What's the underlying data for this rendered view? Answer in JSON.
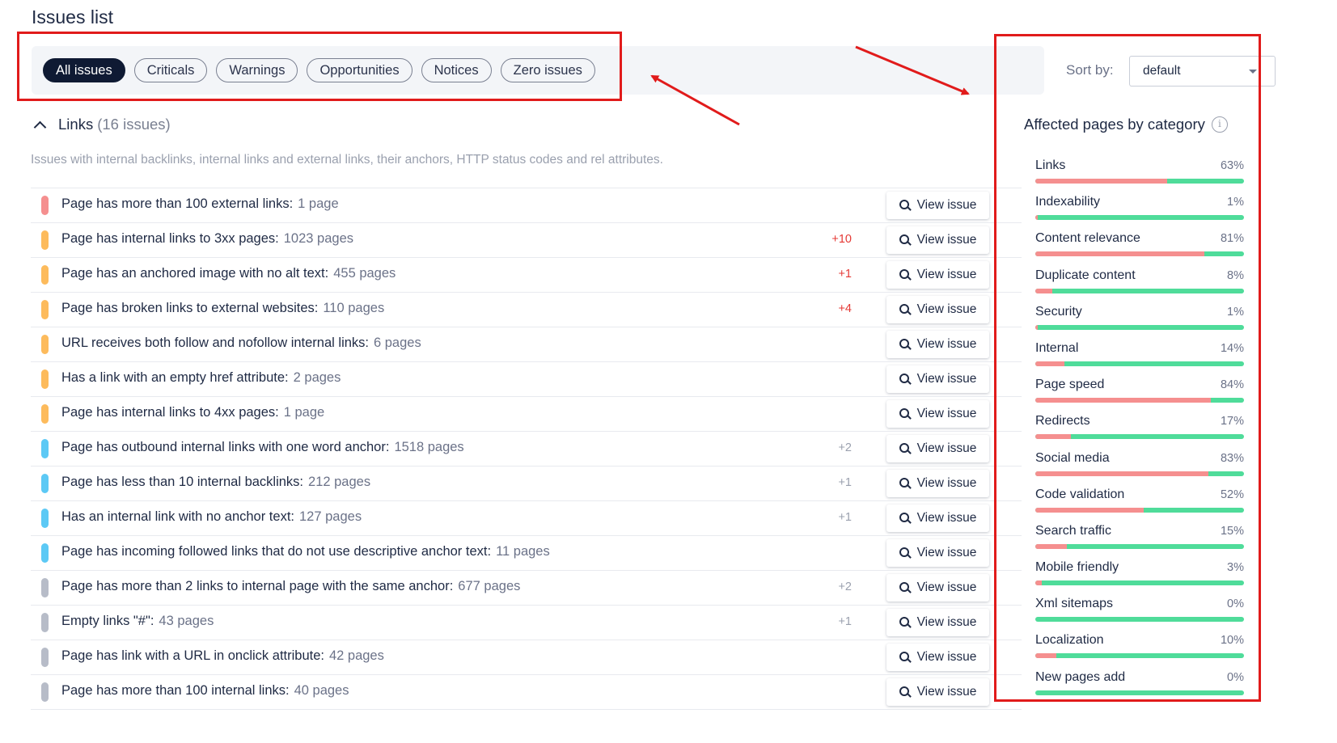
{
  "page_title": "Issues list",
  "filters": {
    "tabs": [
      {
        "label": "All issues",
        "active": true
      },
      {
        "label": "Criticals",
        "active": false
      },
      {
        "label": "Warnings",
        "active": false
      },
      {
        "label": "Opportunities",
        "active": false
      },
      {
        "label": "Notices",
        "active": false
      },
      {
        "label": "Zero issues",
        "active": false
      }
    ]
  },
  "sort": {
    "label": "Sort by:",
    "value": "default"
  },
  "section": {
    "title": "Links",
    "count": "(16 issues)",
    "description": "Issues with internal backlinks, internal links and external links, their anchors, HTTP status codes and rel attributes."
  },
  "colors": {
    "critical": "#f58f8f",
    "warning": "#fdbb5c",
    "opportunity": "#5cc9f5",
    "notice": "#b7bcc8",
    "delta_up": "#e53935",
    "delta_neutral": "#9aa0ae",
    "bar_affected": "#f58f8f",
    "bar_ok": "#4fdc9a",
    "annotation": "#e11b1b"
  },
  "view_label": "View issue",
  "issues": [
    {
      "text": "Page has more than 100 external links:",
      "count": "1 page",
      "delta": "",
      "severity": "critical"
    },
    {
      "text": "Page has internal links to 3xx pages:",
      "count": "1023 pages",
      "delta": "+10",
      "severity": "warning"
    },
    {
      "text": "Page has an anchored image with no alt text:",
      "count": "455 pages",
      "delta": "+1",
      "severity": "warning"
    },
    {
      "text": "Page has broken links to external websites:",
      "count": "110 pages",
      "delta": "+4",
      "severity": "warning"
    },
    {
      "text": "URL receives both follow and nofollow internal links:",
      "count": "6 pages",
      "delta": "",
      "severity": "warning"
    },
    {
      "text": "Has a link with an empty href attribute:",
      "count": "2 pages",
      "delta": "",
      "severity": "warning"
    },
    {
      "text": "Page has internal links to 4xx pages:",
      "count": "1 page",
      "delta": "",
      "severity": "warning"
    },
    {
      "text": "Page has outbound internal links with one word anchor:",
      "count": "1518 pages",
      "delta": "+2",
      "severity": "opportunity"
    },
    {
      "text": "Page has less than 10 internal backlinks:",
      "count": "212 pages",
      "delta": "+1",
      "severity": "opportunity"
    },
    {
      "text": "Has an internal link with no anchor text:",
      "count": "127 pages",
      "delta": "+1",
      "severity": "opportunity"
    },
    {
      "text": "Page has incoming followed links that do not use descriptive anchor text:",
      "count": "11 pages",
      "delta": "",
      "severity": "opportunity"
    },
    {
      "text": "Page has more than 2 links to internal page with the same anchor:",
      "count": "677 pages",
      "delta": "+2",
      "severity": "notice"
    },
    {
      "text": "Empty links \"#\":",
      "count": "43 pages",
      "delta": "+1",
      "severity": "notice"
    },
    {
      "text": "Page has link with a URL in onclick attribute:",
      "count": "42 pages",
      "delta": "",
      "severity": "notice"
    },
    {
      "text": "Page has more than 100 internal links:",
      "count": "40 pages",
      "delta": "",
      "severity": "notice"
    }
  ],
  "affected": {
    "title": "Affected pages by category",
    "categories": [
      {
        "name": "Links",
        "percent": "63%",
        "fraction": 0.63
      },
      {
        "name": "Indexability",
        "percent": "1%",
        "fraction": 0.01
      },
      {
        "name": "Content relevance",
        "percent": "81%",
        "fraction": 0.81
      },
      {
        "name": "Duplicate content",
        "percent": "8%",
        "fraction": 0.08
      },
      {
        "name": "Security",
        "percent": "1%",
        "fraction": 0.01
      },
      {
        "name": "Internal",
        "percent": "14%",
        "fraction": 0.14
      },
      {
        "name": "Page speed",
        "percent": "84%",
        "fraction": 0.84
      },
      {
        "name": "Redirects",
        "percent": "17%",
        "fraction": 0.17
      },
      {
        "name": "Social media",
        "percent": "83%",
        "fraction": 0.83
      },
      {
        "name": "Code validation",
        "percent": "52%",
        "fraction": 0.52
      },
      {
        "name": "Search traffic",
        "percent": "15%",
        "fraction": 0.15
      },
      {
        "name": "Mobile friendly",
        "percent": "3%",
        "fraction": 0.03
      },
      {
        "name": "Xml sitemaps",
        "percent": "0%",
        "fraction": 0.0
      },
      {
        "name": "Localization",
        "percent": "10%",
        "fraction": 0.1
      },
      {
        "name": "New pages add",
        "percent": "0%",
        "fraction": 0.0
      }
    ]
  }
}
